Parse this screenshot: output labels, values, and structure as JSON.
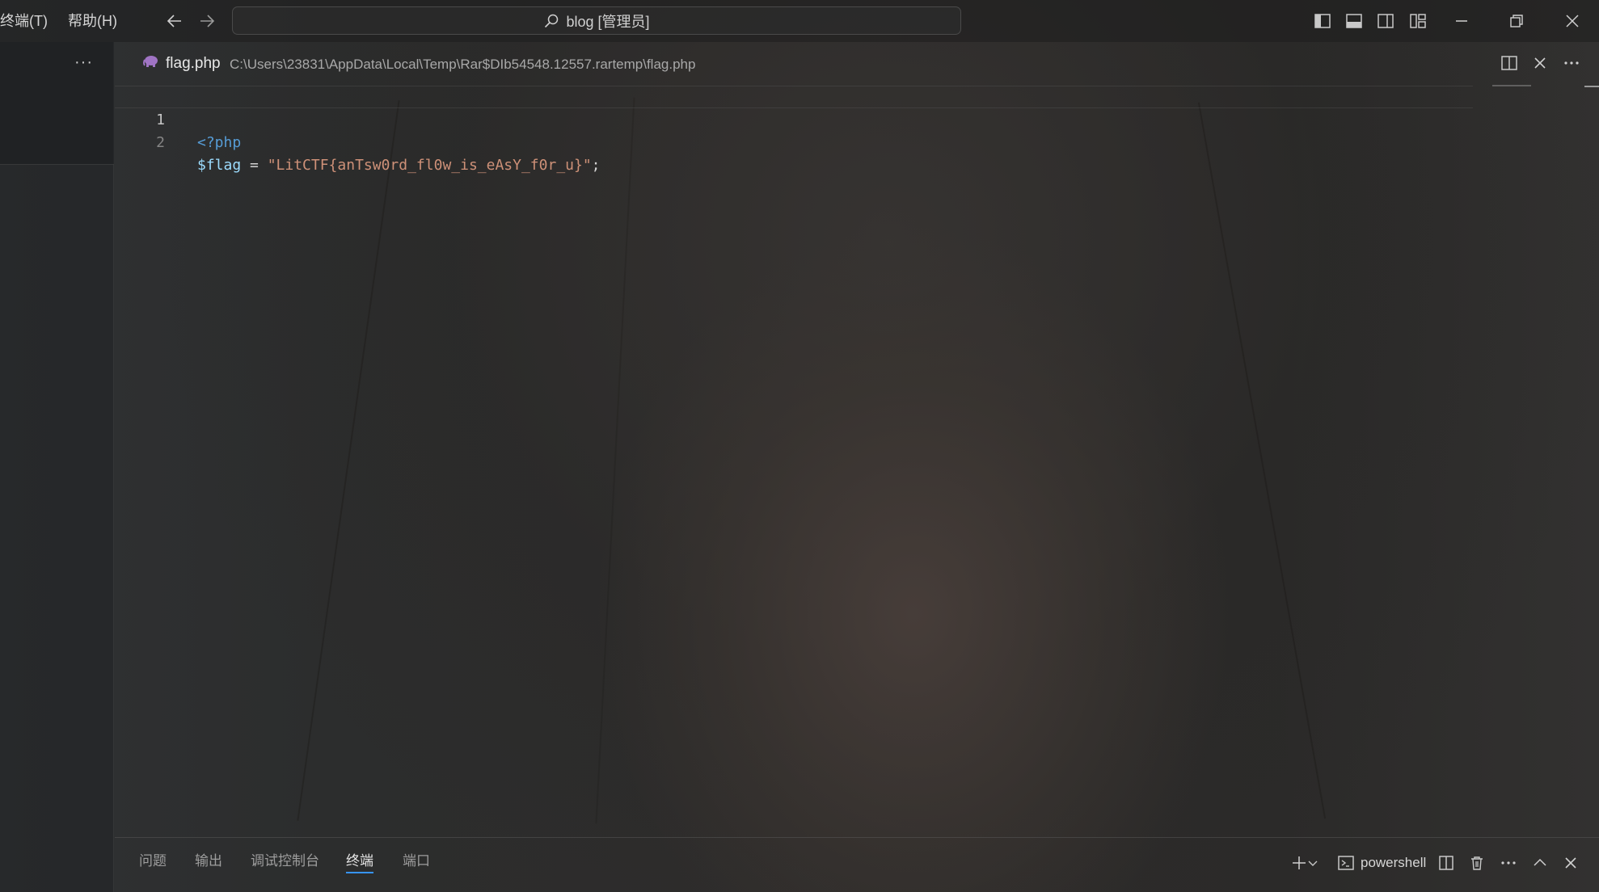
{
  "menu": {
    "terminal": "终端(T)",
    "help": "帮助(H)"
  },
  "command_center": {
    "text": "blog [管理员]",
    "icon": "search-icon"
  },
  "title_icons": [
    "toggle-primary-sidebar-icon",
    "toggle-panel-icon",
    "toggle-secondary-sidebar-icon",
    "customize-layout-icon",
    "minimize-icon",
    "restore-icon",
    "close-icon"
  ],
  "sidebar": {
    "more": "···"
  },
  "editor": {
    "file_name": "flag.php",
    "file_path": "C:\\Users\\23831\\AppData\\Local\\Temp\\Rar$DIb54548.12557.rartemp\\flag.php",
    "file_icon": "php-elephant-icon",
    "lines": [
      {
        "number": "1",
        "tokens": [
          {
            "t": "<?php",
            "c": "tag"
          }
        ]
      },
      {
        "number": "2",
        "tokens": [
          {
            "t": "$flag",
            "c": "var"
          },
          {
            "t": " = ",
            "c": "op"
          },
          {
            "t": "\"LitCTF{anTsw0rd_fl0w_is_eAsY_f0r_u}\"",
            "c": "str"
          },
          {
            "t": ";",
            "c": "op"
          }
        ]
      }
    ]
  },
  "panel": {
    "tabs": [
      "问题",
      "输出",
      "调试控制台",
      "终端",
      "端口"
    ],
    "active_tab": "终端",
    "terminal_name": "powershell"
  },
  "colors": {
    "accent": "#3794ff",
    "keyword": "#569cd6",
    "variable": "#9cdcfe",
    "string": "#ce9178",
    "php_icon": "#a074c4"
  }
}
